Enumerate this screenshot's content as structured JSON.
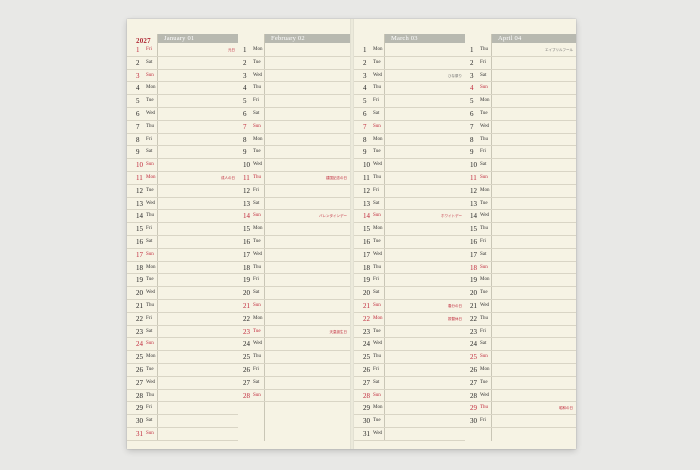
{
  "year": "2027",
  "months": [
    {
      "name": "January 01",
      "days": [
        {
          "d": "1",
          "w": "Fri",
          "note": "元日",
          "red": true
        },
        {
          "d": "2",
          "w": "Sat"
        },
        {
          "d": "3",
          "w": "Sun",
          "red": true
        },
        {
          "d": "4",
          "w": "Mon"
        },
        {
          "d": "5",
          "w": "Tue"
        },
        {
          "d": "6",
          "w": "Wed"
        },
        {
          "d": "7",
          "w": "Thu"
        },
        {
          "d": "8",
          "w": "Fri"
        },
        {
          "d": "9",
          "w": "Sat"
        },
        {
          "d": "10",
          "w": "Sun",
          "red": true
        },
        {
          "d": "11",
          "w": "Mon",
          "red": true,
          "note": "成人の日"
        },
        {
          "d": "12",
          "w": "Tue"
        },
        {
          "d": "13",
          "w": "Wed"
        },
        {
          "d": "14",
          "w": "Thu"
        },
        {
          "d": "15",
          "w": "Fri"
        },
        {
          "d": "16",
          "w": "Sat"
        },
        {
          "d": "17",
          "w": "Sun",
          "red": true
        },
        {
          "d": "18",
          "w": "Mon"
        },
        {
          "d": "19",
          "w": "Tue"
        },
        {
          "d": "20",
          "w": "Wed"
        },
        {
          "d": "21",
          "w": "Thu"
        },
        {
          "d": "22",
          "w": "Fri"
        },
        {
          "d": "23",
          "w": "Sat"
        },
        {
          "d": "24",
          "w": "Sun",
          "red": true
        },
        {
          "d": "25",
          "w": "Mon"
        },
        {
          "d": "26",
          "w": "Tue"
        },
        {
          "d": "27",
          "w": "Wed"
        },
        {
          "d": "28",
          "w": "Thu"
        },
        {
          "d": "29",
          "w": "Fri"
        },
        {
          "d": "30",
          "w": "Sat"
        },
        {
          "d": "31",
          "w": "Sun",
          "red": true
        }
      ]
    },
    {
      "name": "February 02",
      "days": [
        {
          "d": "1",
          "w": "Mon"
        },
        {
          "d": "2",
          "w": "Tue"
        },
        {
          "d": "3",
          "w": "Wed"
        },
        {
          "d": "4",
          "w": "Thu"
        },
        {
          "d": "5",
          "w": "Fri"
        },
        {
          "d": "6",
          "w": "Sat"
        },
        {
          "d": "7",
          "w": "Sun",
          "red": true
        },
        {
          "d": "8",
          "w": "Mon"
        },
        {
          "d": "9",
          "w": "Tue"
        },
        {
          "d": "10",
          "w": "Wed"
        },
        {
          "d": "11",
          "w": "Thu",
          "red": true,
          "note": "建国記念の日"
        },
        {
          "d": "12",
          "w": "Fri"
        },
        {
          "d": "13",
          "w": "Sat"
        },
        {
          "d": "14",
          "w": "Sun",
          "red": true,
          "note": "バレンタインデー"
        },
        {
          "d": "15",
          "w": "Mon"
        },
        {
          "d": "16",
          "w": "Tue"
        },
        {
          "d": "17",
          "w": "Wed"
        },
        {
          "d": "18",
          "w": "Thu"
        },
        {
          "d": "19",
          "w": "Fri"
        },
        {
          "d": "20",
          "w": "Sat"
        },
        {
          "d": "21",
          "w": "Sun",
          "red": true
        },
        {
          "d": "22",
          "w": "Mon"
        },
        {
          "d": "23",
          "w": "Tue",
          "red": true,
          "note": "天皇誕生日"
        },
        {
          "d": "24",
          "w": "Wed"
        },
        {
          "d": "25",
          "w": "Thu"
        },
        {
          "d": "26",
          "w": "Fri"
        },
        {
          "d": "27",
          "w": "Sat"
        },
        {
          "d": "28",
          "w": "Sun",
          "red": true
        }
      ]
    },
    {
      "name": "March 03",
      "days": [
        {
          "d": "1",
          "w": "Mon"
        },
        {
          "d": "2",
          "w": "Tue"
        },
        {
          "d": "3",
          "w": "Wed",
          "note": "ひな祭り"
        },
        {
          "d": "4",
          "w": "Thu"
        },
        {
          "d": "5",
          "w": "Fri"
        },
        {
          "d": "6",
          "w": "Sat"
        },
        {
          "d": "7",
          "w": "Sun",
          "red": true
        },
        {
          "d": "8",
          "w": "Mon"
        },
        {
          "d": "9",
          "w": "Tue"
        },
        {
          "d": "10",
          "w": "Wed"
        },
        {
          "d": "11",
          "w": "Thu"
        },
        {
          "d": "12",
          "w": "Fri"
        },
        {
          "d": "13",
          "w": "Sat"
        },
        {
          "d": "14",
          "w": "Sun",
          "red": true,
          "note": "ホワイトデー"
        },
        {
          "d": "15",
          "w": "Mon"
        },
        {
          "d": "16",
          "w": "Tue"
        },
        {
          "d": "17",
          "w": "Wed"
        },
        {
          "d": "18",
          "w": "Thu"
        },
        {
          "d": "19",
          "w": "Fri"
        },
        {
          "d": "20",
          "w": "Sat"
        },
        {
          "d": "21",
          "w": "Sun",
          "red": true,
          "note": "春分の日"
        },
        {
          "d": "22",
          "w": "Mon",
          "red": true,
          "note": "振替休日"
        },
        {
          "d": "23",
          "w": "Tue"
        },
        {
          "d": "24",
          "w": "Wed"
        },
        {
          "d": "25",
          "w": "Thu"
        },
        {
          "d": "26",
          "w": "Fri"
        },
        {
          "d": "27",
          "w": "Sat"
        },
        {
          "d": "28",
          "w": "Sun",
          "red": true
        },
        {
          "d": "29",
          "w": "Mon"
        },
        {
          "d": "30",
          "w": "Tue"
        },
        {
          "d": "31",
          "w": "Wed"
        }
      ]
    },
    {
      "name": "April 04",
      "days": [
        {
          "d": "1",
          "w": "Thu",
          "note": "エイプリルフール"
        },
        {
          "d": "2",
          "w": "Fri"
        },
        {
          "d": "3",
          "w": "Sat"
        },
        {
          "d": "4",
          "w": "Sun",
          "red": true
        },
        {
          "d": "5",
          "w": "Mon"
        },
        {
          "d": "6",
          "w": "Tue"
        },
        {
          "d": "7",
          "w": "Wed"
        },
        {
          "d": "8",
          "w": "Thu"
        },
        {
          "d": "9",
          "w": "Fri"
        },
        {
          "d": "10",
          "w": "Sat"
        },
        {
          "d": "11",
          "w": "Sun",
          "red": true
        },
        {
          "d": "12",
          "w": "Mon"
        },
        {
          "d": "13",
          "w": "Tue"
        },
        {
          "d": "14",
          "w": "Wed"
        },
        {
          "d": "15",
          "w": "Thu"
        },
        {
          "d": "16",
          "w": "Fri"
        },
        {
          "d": "17",
          "w": "Sat"
        },
        {
          "d": "18",
          "w": "Sun",
          "red": true
        },
        {
          "d": "19",
          "w": "Mon"
        },
        {
          "d": "20",
          "w": "Tue"
        },
        {
          "d": "21",
          "w": "Wed"
        },
        {
          "d": "22",
          "w": "Thu"
        },
        {
          "d": "23",
          "w": "Fri"
        },
        {
          "d": "24",
          "w": "Sat"
        },
        {
          "d": "25",
          "w": "Sun",
          "red": true
        },
        {
          "d": "26",
          "w": "Mon"
        },
        {
          "d": "27",
          "w": "Tue"
        },
        {
          "d": "28",
          "w": "Wed"
        },
        {
          "d": "29",
          "w": "Thu",
          "red": true,
          "note": "昭和の日"
        },
        {
          "d": "30",
          "w": "Fri"
        }
      ]
    }
  ],
  "colors": {
    "paper": "#f6f3e4",
    "header": "#b8b9b0",
    "holiday": "#c0283a",
    "background": "#e8e8e6"
  }
}
